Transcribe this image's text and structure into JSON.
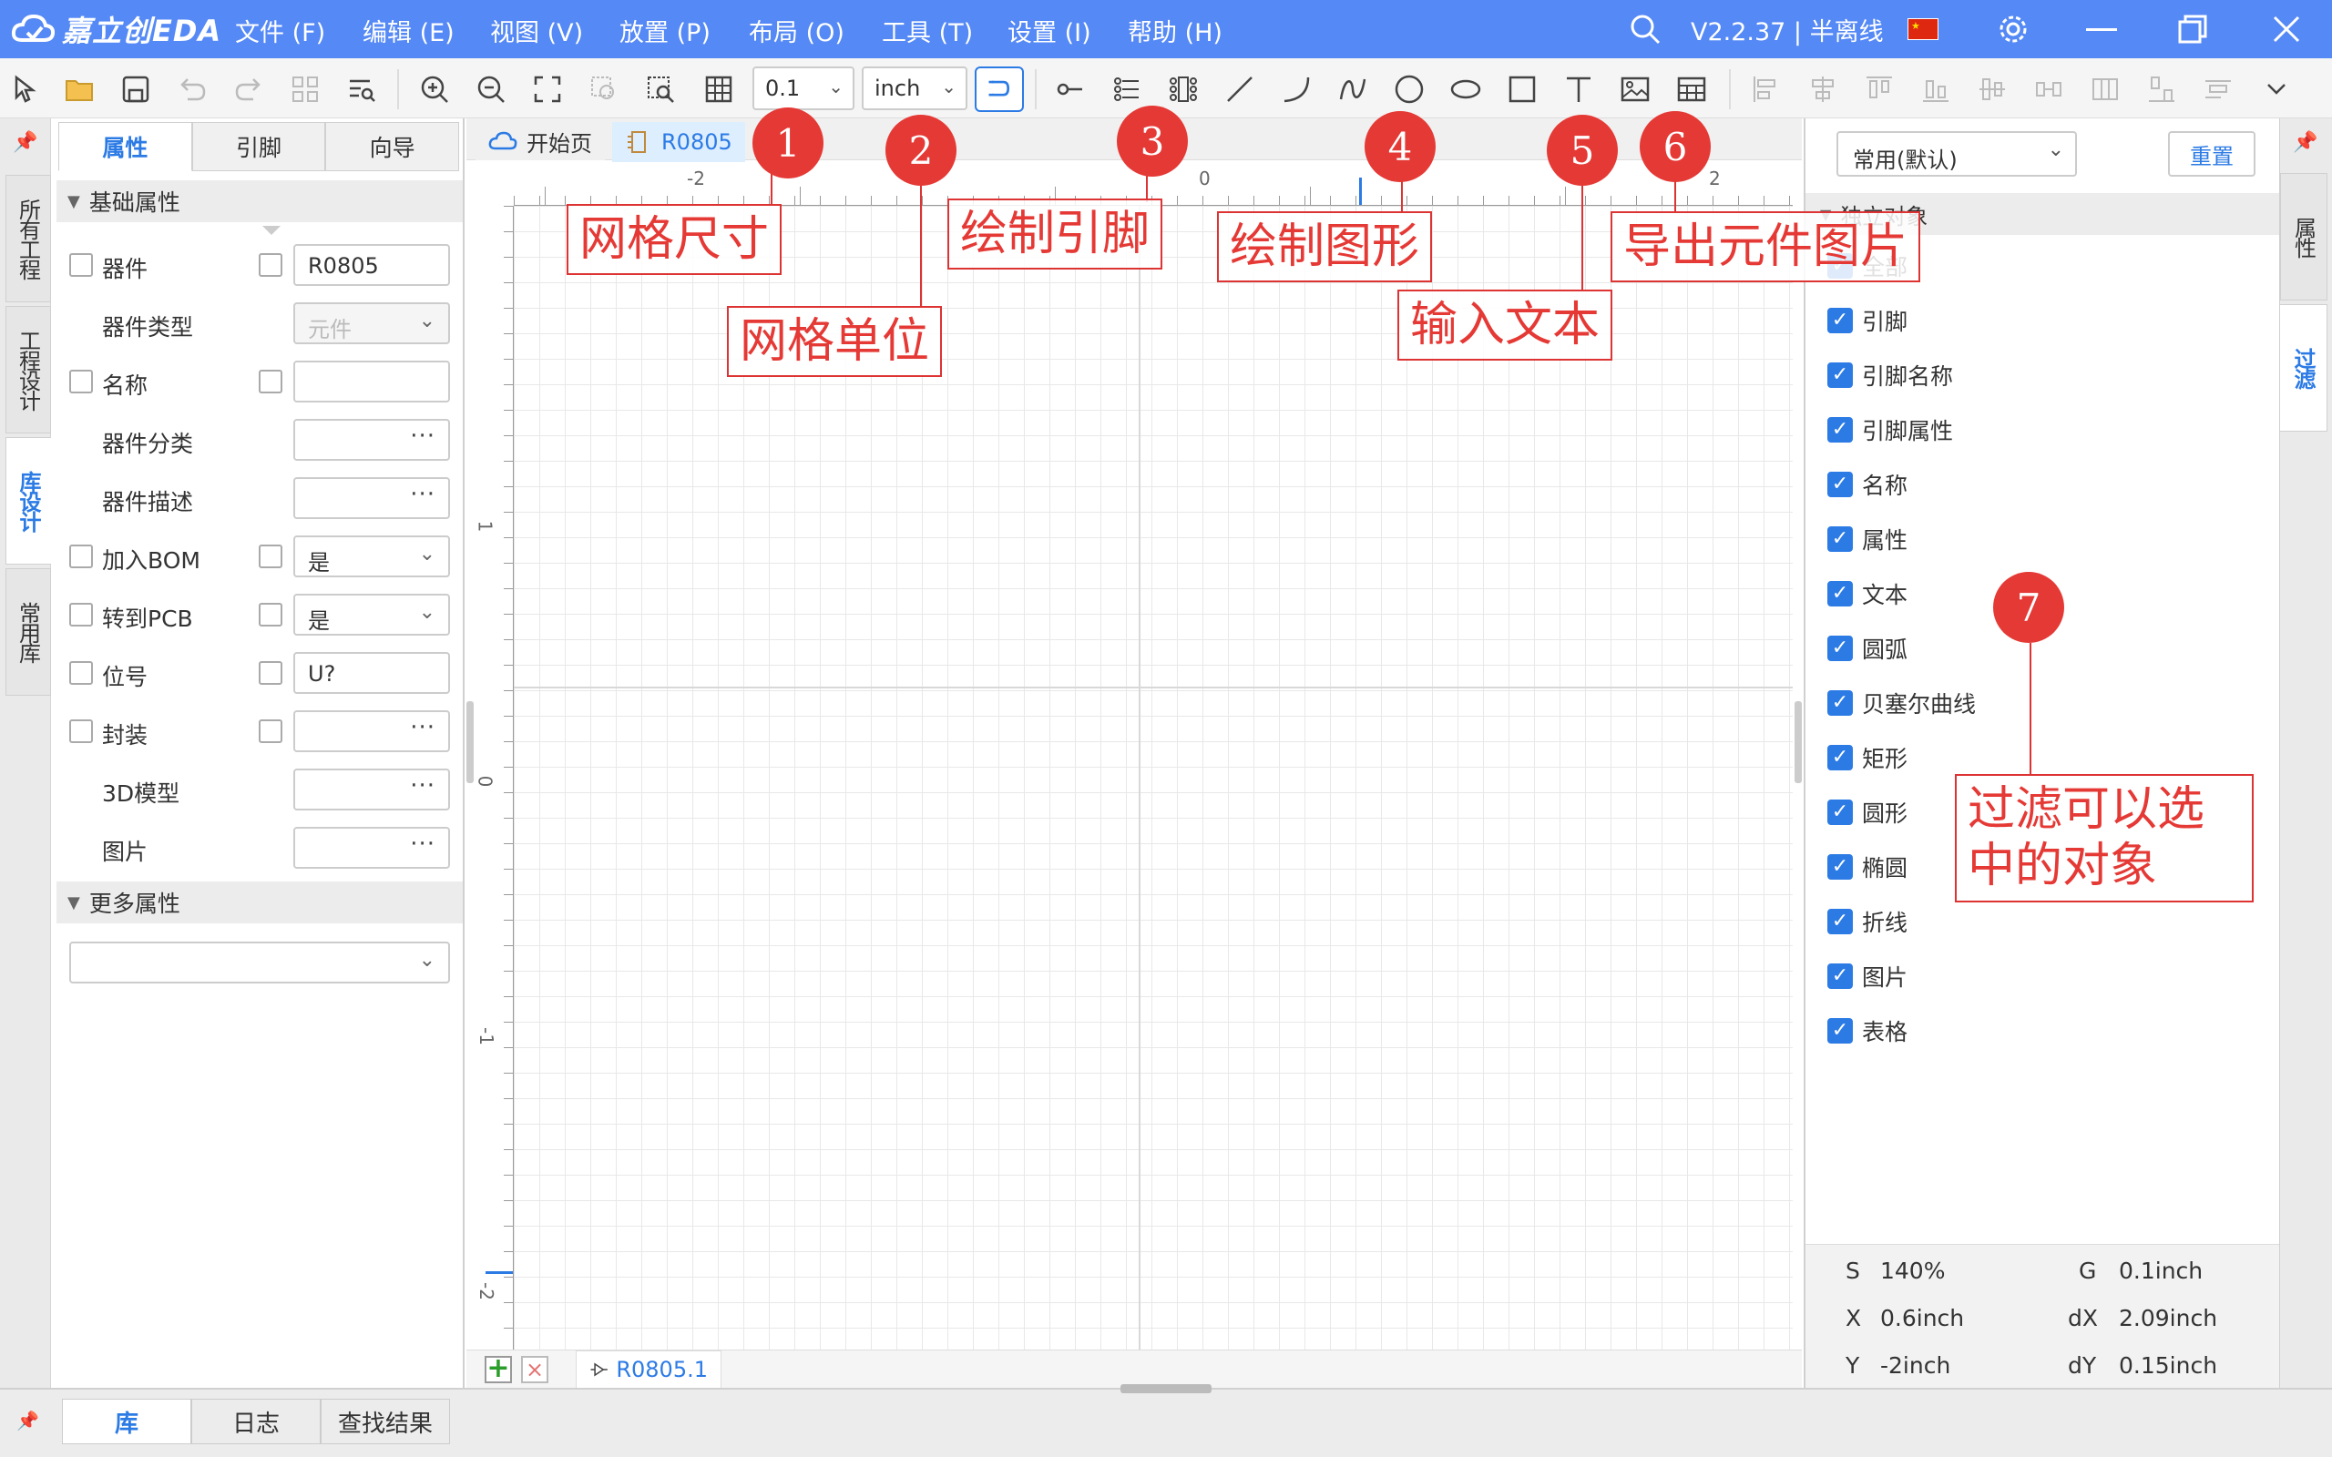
{
  "app": {
    "logo_text": "嘉立创EDA",
    "version": "V2.2.37 | 半离线"
  },
  "menu": [
    "文件 (F)",
    "编辑 (E)",
    "视图 (V)",
    "放置 (P)",
    "布局 (O)",
    "工具 (T)",
    "设置 (I)",
    "帮助 (H)"
  ],
  "toolbar": {
    "grid_size": "0.1",
    "grid_unit": "inch"
  },
  "left_tabs": [
    "所有工程",
    "工程设计",
    "库设计",
    "常用库"
  ],
  "prop_tabs": [
    "属性",
    "引脚",
    "向导"
  ],
  "props": {
    "section_basic": "基础属性",
    "device_label": "器件",
    "device_value": "R0805",
    "device_type_label": "器件类型",
    "device_type_value": "元件",
    "name_label": "名称",
    "category_label": "器件分类",
    "desc_label": "器件描述",
    "bom_label": "加入BOM",
    "bom_value": "是",
    "pcb_label": "转到PCB",
    "pcb_value": "是",
    "ref_label": "位号",
    "ref_value": "U?",
    "footprint_label": "封装",
    "model3d_label": "3D模型",
    "image_label": "图片",
    "section_more": "更多属性",
    "dots": "···"
  },
  "doc_tabs": {
    "start": "开始页",
    "doc": "R0805"
  },
  "canvas_bottom": {
    "sheet": "R0805.1"
  },
  "ruler": {
    "h": [
      "-2",
      "0",
      "2"
    ],
    "v": [
      "1",
      "0",
      "-1",
      "-2"
    ]
  },
  "filter": {
    "preset": "常用(默认)",
    "reset": "重置",
    "section": "独立对象",
    "items": [
      "全部",
      "引脚",
      "引脚名称",
      "引脚属性",
      "名称",
      "属性",
      "文本",
      "圆弧",
      "贝塞尔曲线",
      "矩形",
      "圆形",
      "椭圆",
      "折线",
      "图片",
      "表格"
    ]
  },
  "right_tabs": [
    "属性",
    "过滤"
  ],
  "status": {
    "s_label": "S",
    "s_value": "140%",
    "g_label": "G",
    "g_value": "0.1inch",
    "x_label": "X",
    "x_value": "0.6inch",
    "dx_label": "dX",
    "dx_value": "2.09inch",
    "y_label": "Y",
    "y_value": "-2inch",
    "dy_label": "dY",
    "dy_value": "0.15inch"
  },
  "bottom_tabs": [
    "库",
    "日志",
    "查找结果"
  ],
  "annotations": [
    {
      "num": "1",
      "text": "网格尺寸"
    },
    {
      "num": "2",
      "text": "网格单位"
    },
    {
      "num": "3",
      "text": "绘制引脚"
    },
    {
      "num": "4",
      "text": "绘制图形"
    },
    {
      "num": "5",
      "text": "输入文本"
    },
    {
      "num": "6",
      "text": "导出元件图片"
    },
    {
      "num": "7",
      "text": "过滤可以选中的对象"
    }
  ]
}
